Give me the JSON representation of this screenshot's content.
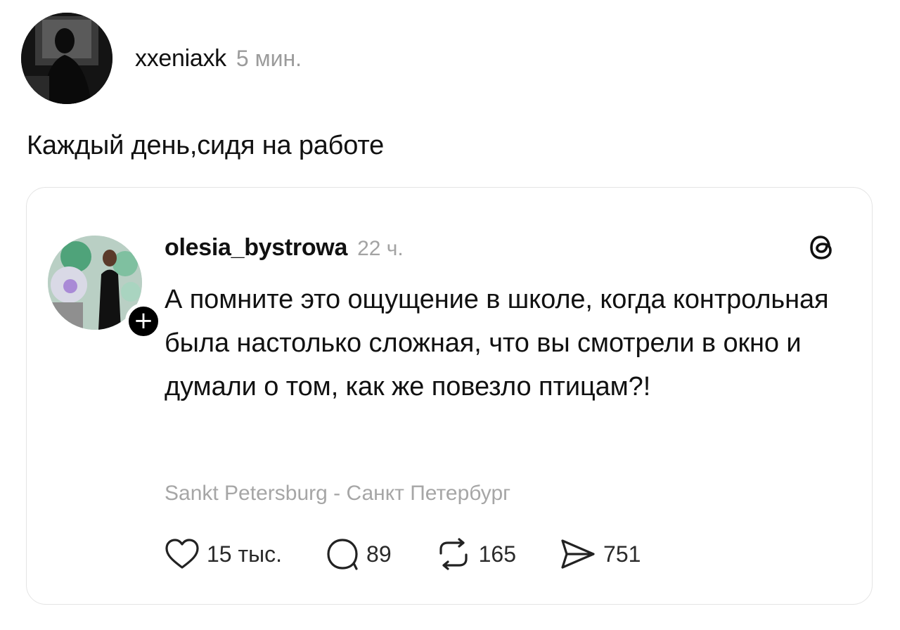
{
  "post": {
    "author": "xxeniaxk",
    "time": "5 мин.",
    "text": "Каждый день,сидя на работе"
  },
  "quoted": {
    "author": "olesia_bystrowa",
    "time": "22 ч.",
    "text": "А помните это ощущение в школе, когда контрольная была настолько сложная, что вы смотрели в окно и думали о том, как же повезло птицам?!",
    "location": "Sankt Petersburg - Санкт Петербург",
    "follow_badge": "+",
    "app_icon": "threads-icon",
    "stats": {
      "likes": "15 тыс.",
      "comments": "89",
      "reposts": "165",
      "shares": "751"
    }
  }
}
